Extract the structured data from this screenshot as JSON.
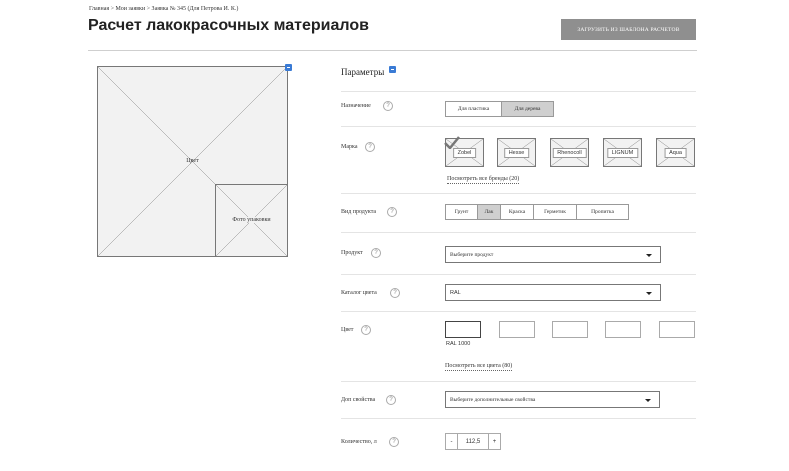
{
  "breadcrumb": "Главная > Мои заявки > Заявка № 345 (Для Петрова И. К.)",
  "page_title": "Расчет лакокрасочных материалов",
  "template_button": "ЗАГРУЗИТЬ ИЗ ШАБЛОНА РАСЧЕТОВ",
  "images": {
    "main_label": "Цвет",
    "package_label": "Фото упаковки"
  },
  "params": {
    "title": "Параметры",
    "purpose": {
      "label": "Назначение",
      "options": [
        "Для пластика",
        "Для дерева"
      ],
      "selected": "Для дерева"
    },
    "brand": {
      "label": "Марка",
      "options": [
        "Zobel",
        "Hesse",
        "Rhenocoll",
        "LIGNUM",
        "Aqua"
      ],
      "selected": "Zobel",
      "all_link": "Посмотреть все бренды (20)"
    },
    "product_type": {
      "label": "Вид продукта",
      "options": [
        "Грунт",
        "Лак",
        "Краска",
        "Герметик",
        "Пропитка"
      ],
      "selected": "Лак"
    },
    "product": {
      "label": "Продукт",
      "placeholder": "Выберите продукт"
    },
    "color_catalog": {
      "label": "Каталог цвета",
      "value": "RAL"
    },
    "color": {
      "label": "Цвет",
      "selected_caption": "RAL 1000",
      "all_link": "Посмотреть все цвета (80)"
    },
    "extra": {
      "label": "Доп свойства",
      "placeholder": "Выберите дополнительные свойства"
    },
    "quantity": {
      "label": "Количество, л",
      "minus": "-",
      "value": "112,5",
      "plus": "+"
    },
    "help_glyph": "?"
  },
  "colors": {
    "accent_badge": "#3a7bd5",
    "template_button_bg": "#8f8f8f",
    "segment_active_bg": "#cfcfcf"
  }
}
